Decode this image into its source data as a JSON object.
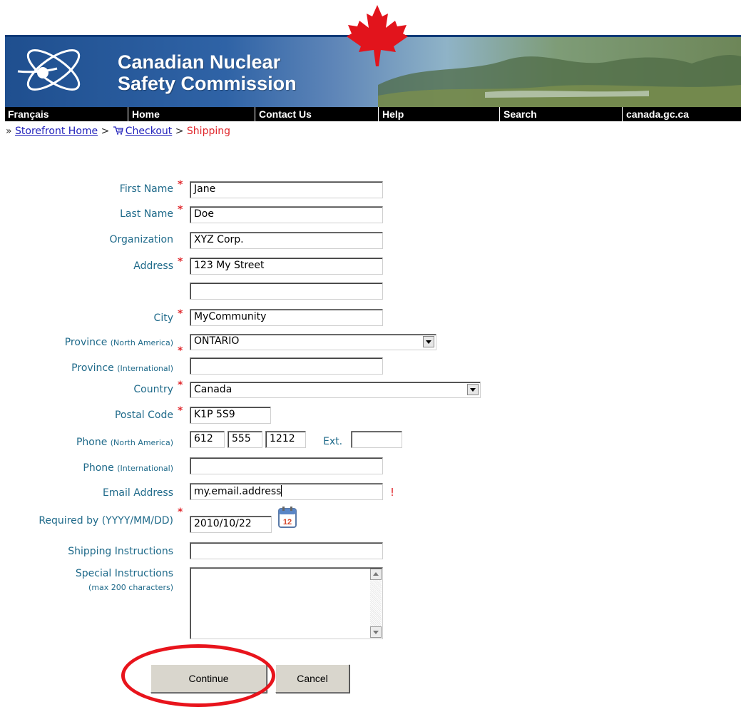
{
  "brand": {
    "line1": "Canadian Nuclear",
    "line2": "Safety Commission"
  },
  "nav": [
    "Français",
    "Home",
    "Contact Us",
    "Help",
    "Search",
    "canada.gc.ca"
  ],
  "breadcrumb": {
    "prefix": "»",
    "home": "Storefront Home",
    "sep": ">",
    "checkout": "Checkout",
    "current": "Shipping"
  },
  "form": {
    "first_name": {
      "label": "First Name",
      "value": "Jane"
    },
    "last_name": {
      "label": "Last Name",
      "value": "Doe"
    },
    "organization": {
      "label": "Organization",
      "value": "XYZ Corp."
    },
    "address": {
      "label": "Address",
      "value": "123 My Street",
      "value2": ""
    },
    "city": {
      "label": "City",
      "value": "MyCommunity"
    },
    "province_na": {
      "label": "Province",
      "qualifier": "(North America)",
      "value": "ONTARIO"
    },
    "province_intl": {
      "label": "Province",
      "qualifier": "(International)",
      "value": ""
    },
    "country": {
      "label": "Country",
      "value": "Canada"
    },
    "postal_code": {
      "label": "Postal Code",
      "value": "K1P 5S9"
    },
    "phone_na": {
      "label": "Phone",
      "qualifier": "(North America)",
      "area": "612",
      "exchange": "555",
      "number": "1212",
      "ext_label": "Ext.",
      "ext": ""
    },
    "phone_intl": {
      "label": "Phone",
      "qualifier": "(International)",
      "value": ""
    },
    "email": {
      "label": "Email Address",
      "value": "my.email.address",
      "error": "!"
    },
    "required_by": {
      "label": "Required by (YYYY/MM/DD)",
      "value": "2010/10/22",
      "calendar_day": "12"
    },
    "shipping_instructions": {
      "label": "Shipping Instructions",
      "value": ""
    },
    "special_instructions": {
      "label": "Special Instructions",
      "note": "(max 200 characters)",
      "value": ""
    },
    "required_mark": "*"
  },
  "buttons": {
    "continue": "Continue",
    "cancel": "Cancel"
  },
  "colors": {
    "label": "#1f6a8a",
    "required": "#e0262b",
    "highlight": "#e8141c",
    "nav_bg": "#000000"
  }
}
